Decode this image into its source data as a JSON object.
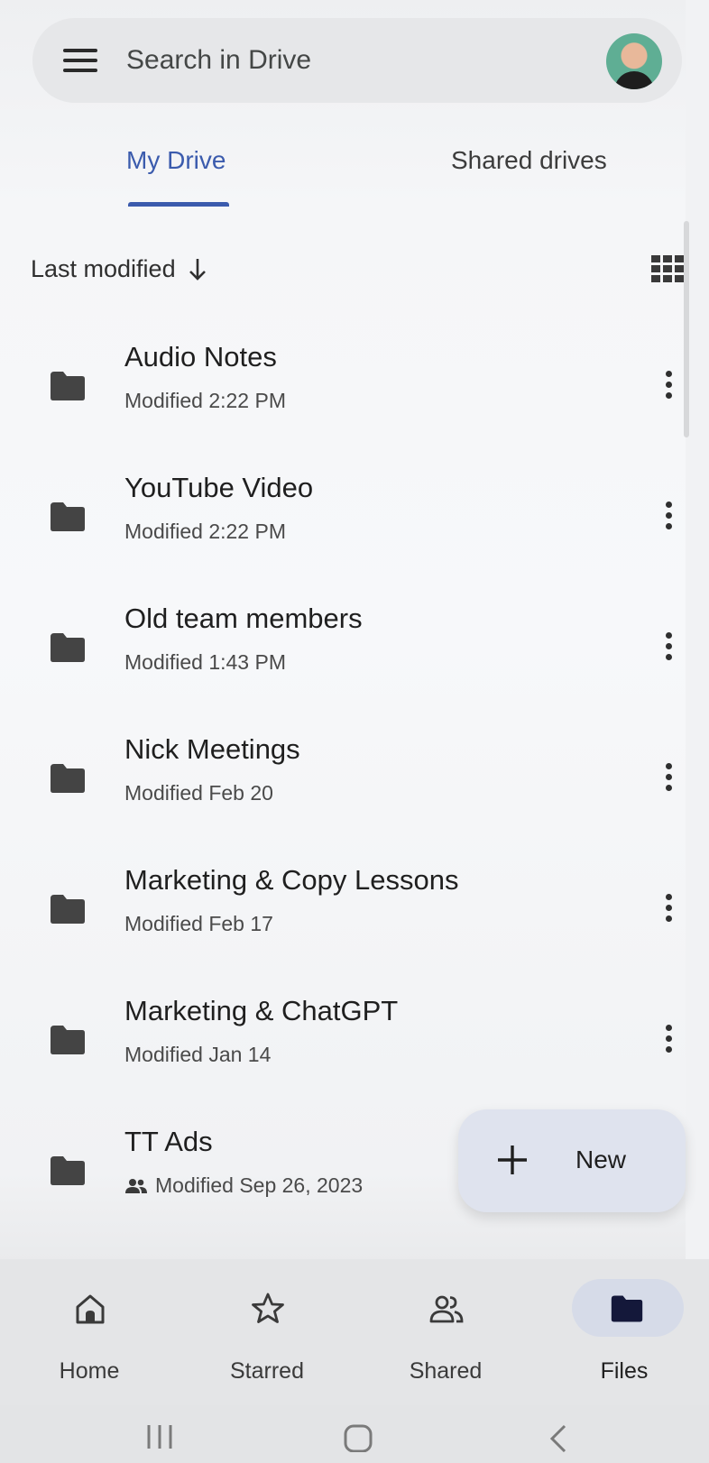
{
  "search": {
    "placeholder": "Search in Drive"
  },
  "tabs": [
    {
      "label": "My Drive",
      "active": true
    },
    {
      "label": "Shared drives",
      "active": false
    }
  ],
  "sort": {
    "label": "Last modified",
    "direction_icon": "arrow-down-icon"
  },
  "view_toggle_icon": "grid-view-icon",
  "folders": [
    {
      "name": "Audio Notes",
      "modified": "Modified 2:22 PM",
      "shared": false
    },
    {
      "name": "YouTube Video",
      "modified": "Modified 2:22 PM",
      "shared": false
    },
    {
      "name": "Old team members",
      "modified": "Modified 1:43 PM",
      "shared": false
    },
    {
      "name": "Nick Meetings",
      "modified": "Modified Feb 20",
      "shared": false
    },
    {
      "name": "Marketing & Copy Lessons",
      "modified": "Modified Feb 17",
      "shared": false
    },
    {
      "name": "Marketing & ChatGPT",
      "modified": "Modified Jan 14",
      "shared": false
    },
    {
      "name": "TT Ads",
      "modified": "Modified Sep 26, 2023",
      "shared": true
    }
  ],
  "fab": {
    "label": "New",
    "icon": "plus-icon"
  },
  "bottom_nav": [
    {
      "label": "Home",
      "icon": "home-icon",
      "active": false
    },
    {
      "label": "Starred",
      "icon": "star-icon",
      "active": false
    },
    {
      "label": "Shared",
      "icon": "people-icon",
      "active": false
    },
    {
      "label": "Files",
      "icon": "folder-icon",
      "active": true
    }
  ],
  "colors": {
    "accent": "#3b5bad",
    "background": "#f5f6f8",
    "fab_background": "#dfe3ee",
    "nav_active_pill": "#d6dbe8"
  }
}
